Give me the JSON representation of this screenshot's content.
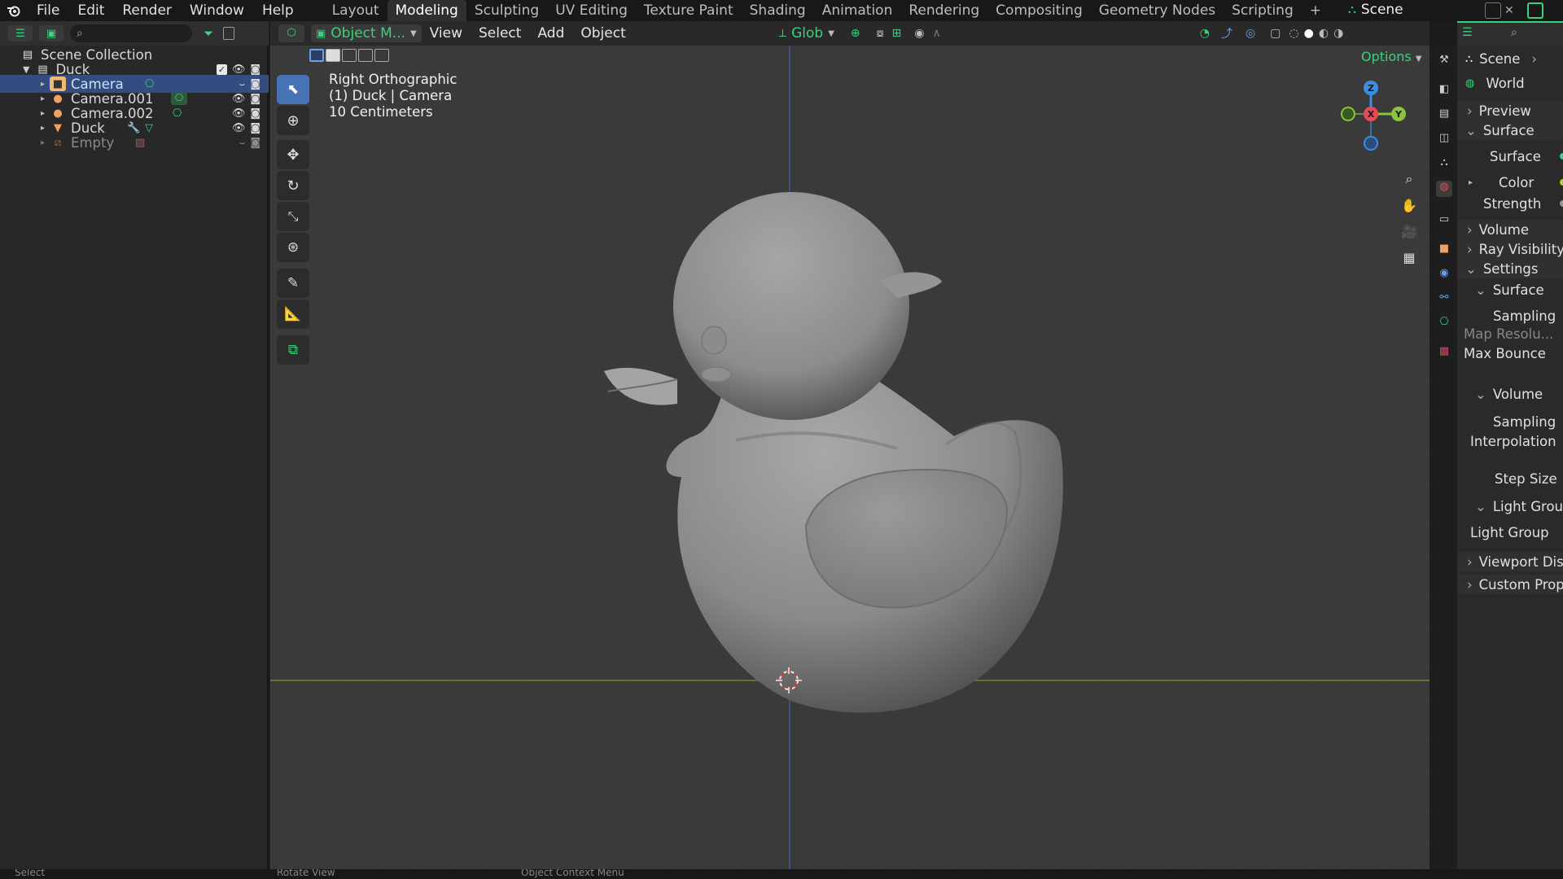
{
  "menubar": {
    "items": [
      "File",
      "Edit",
      "Render",
      "Window",
      "Help"
    ],
    "workspaces": [
      "Layout",
      "Modeling",
      "Sculpting",
      "UV Editing",
      "Texture Paint",
      "Shading",
      "Animation",
      "Rendering",
      "Compositing",
      "Geometry Nodes",
      "Scripting",
      "+"
    ],
    "active_workspace": "Modeling",
    "scene_name": "Scene"
  },
  "outliner": {
    "collection_title": "Scene Collection",
    "rows": [
      {
        "label": "Duck",
        "type": "collection"
      },
      {
        "label": "Camera",
        "type": "camera",
        "selected": true
      },
      {
        "label": "Camera.001",
        "type": "camera"
      },
      {
        "label": "Camera.002",
        "type": "camera"
      },
      {
        "label": "Duck",
        "type": "mesh"
      },
      {
        "label": "Empty",
        "type": "empty",
        "dimmed": true
      }
    ]
  },
  "viewport": {
    "mode": "Object M...",
    "menus": [
      "View",
      "Select",
      "Add",
      "Object"
    ],
    "transform_orientation": "Glob",
    "options_label": "Options",
    "overlay_text": {
      "line1": "Right Orthographic",
      "line2": "(1) Duck  | Camera",
      "line3": "10 Centimeters"
    },
    "gizmo_axes": {
      "z": "Z",
      "x": "X",
      "y": "Y"
    }
  },
  "properties": {
    "breadcrumb": "Scene",
    "world_name": "World",
    "rows": {
      "preview": "Preview",
      "surface_panel": "Surface",
      "surface_field": "Surface",
      "color": "Color",
      "strength": "Strength",
      "volume": "Volume",
      "ray_visibility": "Ray Visibility",
      "settings": "Settings",
      "settings_surface": "Surface",
      "sampling": "Sampling",
      "map_resolution": "Map Resolu...",
      "max_bounce": "Max Bounce",
      "settings_volume": "Volume",
      "vol_sampling": "Sampling",
      "interpolation": "Interpolation",
      "step_size": "Step Size",
      "light_group_panel": "Light Grou",
      "light_group": "Light Group",
      "viewport_display": "Viewport Dis",
      "custom_props": "Custom Prop"
    }
  },
  "colors": {
    "accent_blue": "#4772b3",
    "selection": "#334d80",
    "x_axis": "#e94a57",
    "y_axis": "#8ac43a",
    "z_axis": "#3a8ee6",
    "header_green": "#3bd17d"
  },
  "statusbar": {
    "items": [
      "Select",
      "Rotate View",
      "Object Context Menu"
    ]
  }
}
